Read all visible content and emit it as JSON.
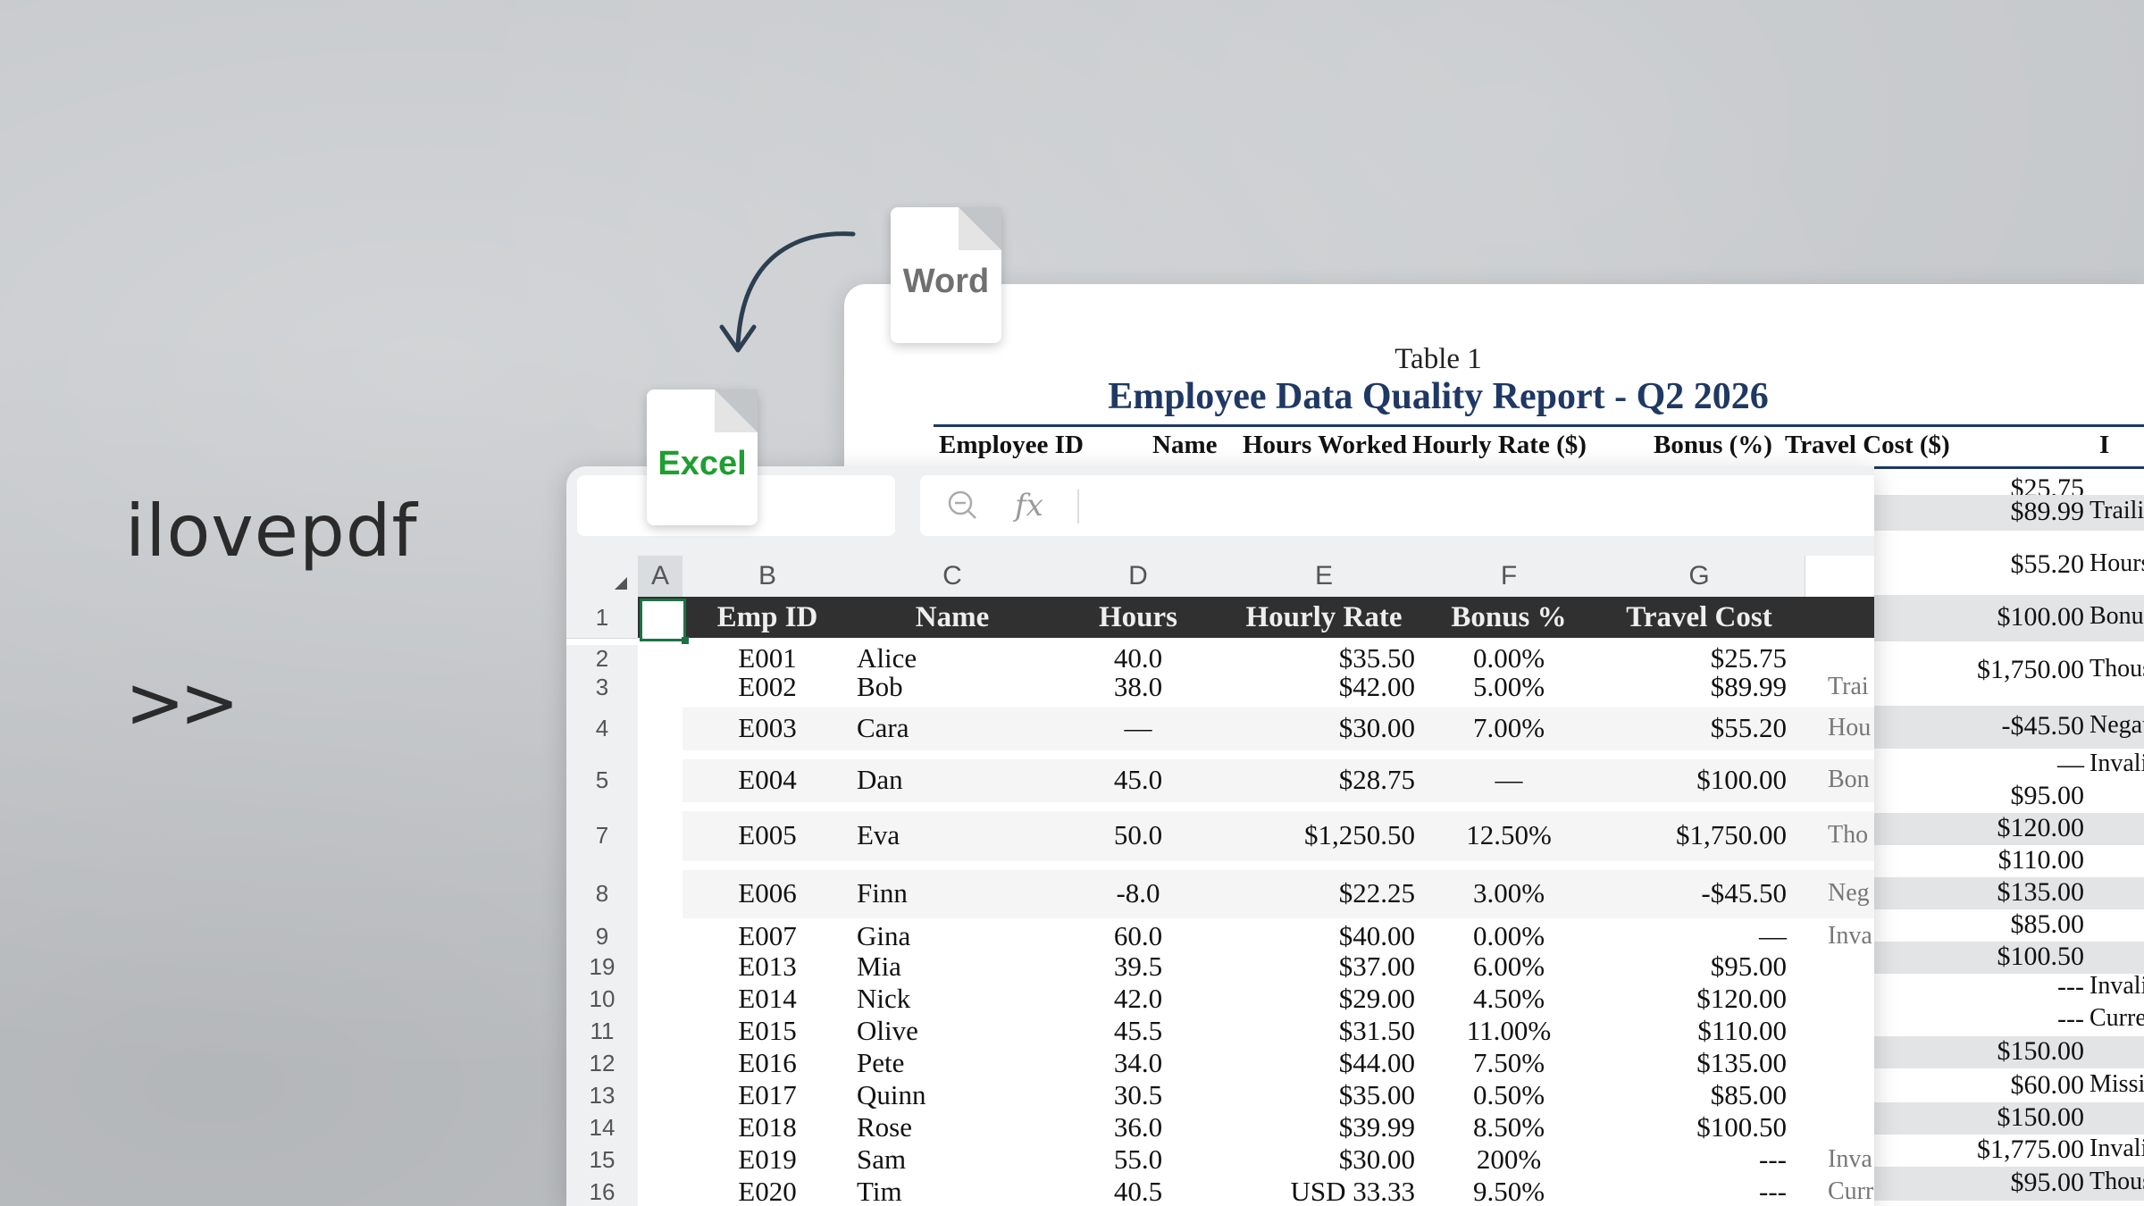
{
  "brand": {
    "name": "ilovepdf",
    "chevrons": ">>"
  },
  "files": {
    "word_label": "Word",
    "excel_label": "Excel",
    "word_color": "#707070",
    "excel_color": "#1f9e31"
  },
  "word_doc": {
    "caption": "Table 1",
    "title": "Employee Data Quality Report - Q2 2026",
    "headers": [
      "Employee ID",
      "Name",
      "Hours Worked",
      "Hourly Rate ($)",
      "Bonus (%)",
      "Travel Cost ($)",
      "I"
    ],
    "rows": [
      {
        "amount": "$25.75",
        "note": ""
      },
      {
        "amount": "$89.99",
        "note": "Trailing s"
      },
      {
        "amount": "$55.20",
        "note": "Hours inv"
      },
      {
        "amount": "$100.00",
        "note": "Bonus inv"
      },
      {
        "amount": "$1,750.00",
        "note": "Thousand"
      },
      {
        "amount": "-$45.50",
        "note": "Negative"
      },
      {
        "amount": "—",
        "note": "Invalid bo"
      },
      {
        "amount": "$95.00",
        "note": ""
      },
      {
        "amount": "$120.00",
        "note": ""
      },
      {
        "amount": "$110.00",
        "note": ""
      },
      {
        "amount": "$135.00",
        "note": ""
      },
      {
        "amount": "$85.00",
        "note": ""
      },
      {
        "amount": "$100.50",
        "note": ""
      },
      {
        "amount": "---",
        "note": "Invalid bo"
      },
      {
        "amount": "---",
        "note": "Currency"
      },
      {
        "amount": "$150.00",
        "note": ""
      },
      {
        "amount": "$60.00",
        "note": "Missing h"
      },
      {
        "amount": "$150.00",
        "note": ""
      },
      {
        "amount": "$1,775.00",
        "note": "Invalid bo"
      },
      {
        "amount": "$95.00",
        "note": "Thousand"
      }
    ]
  },
  "excel": {
    "formula_icon": "fx",
    "columns": [
      "A",
      "B",
      "C",
      "D",
      "E",
      "F",
      "G"
    ],
    "header_row": {
      "row_num": "1",
      "cells": [
        "Emp ID",
        "Name",
        "Hours",
        "Hourly Rate",
        "Bonus %",
        "Travel Cost"
      ]
    },
    "rows": [
      {
        "num": "2",
        "id": "E001",
        "name": "Alice",
        "hours": "40.0",
        "rate": "$35.50",
        "bonus": "0.00%",
        "travel": "$25.75",
        "note": ""
      },
      {
        "num": "3",
        "id": "E002",
        "name": "Bob",
        "hours": "38.0",
        "rate": "$42.00",
        "bonus": "5.00%",
        "travel": "$89.99",
        "note": "Trai"
      },
      {
        "num": "4",
        "id": "E003",
        "name": "Cara",
        "hours": "—",
        "rate": "$30.00",
        "bonus": "7.00%",
        "travel": "$55.20",
        "note": "Hou"
      },
      {
        "num": "5",
        "id": "E004",
        "name": "Dan",
        "hours": "45.0",
        "rate": "$28.75",
        "bonus": "—",
        "travel": "$100.00",
        "note": "Bon"
      },
      {
        "num": "7",
        "id": "E005",
        "name": "Eva",
        "hours": "50.0",
        "rate": "$1,250.50",
        "bonus": "12.50%",
        "travel": "$1,750.00",
        "note": "Tho"
      },
      {
        "num": "8",
        "id": "E006",
        "name": "Finn",
        "hours": "-8.0",
        "rate": "$22.25",
        "bonus": "3.00%",
        "travel": "-$45.50",
        "note": "Neg"
      },
      {
        "num": "9",
        "id": "E007",
        "name": "Gina",
        "hours": "60.0",
        "rate": "$40.00",
        "bonus": "0.00%",
        "travel": "—",
        "note": "Inva"
      },
      {
        "num": "19",
        "id": "E013",
        "name": "Mia",
        "hours": "39.5",
        "rate": "$37.00",
        "bonus": "6.00%",
        "travel": "$95.00",
        "note": ""
      },
      {
        "num": "10",
        "id": "E014",
        "name": "Nick",
        "hours": "42.0",
        "rate": "$29.00",
        "bonus": "4.50%",
        "travel": "$120.00",
        "note": ""
      },
      {
        "num": "11",
        "id": "E015",
        "name": "Olive",
        "hours": "45.5",
        "rate": "$31.50",
        "bonus": "11.00%",
        "travel": "$110.00",
        "note": ""
      },
      {
        "num": "12",
        "id": "E016",
        "name": "Pete",
        "hours": "34.0",
        "rate": "$44.00",
        "bonus": "7.50%",
        "travel": "$135.00",
        "note": ""
      },
      {
        "num": "13",
        "id": "E017",
        "name": "Quinn",
        "hours": "30.5",
        "rate": "$35.00",
        "bonus": "0.50%",
        "travel": "$85.00",
        "note": ""
      },
      {
        "num": "14",
        "id": "E018",
        "name": "Rose",
        "hours": "36.0",
        "rate": "$39.99",
        "bonus": "8.50%",
        "travel": "$100.50",
        "note": ""
      },
      {
        "num": "15",
        "id": "E019",
        "name": "Sam",
        "hours": "55.0",
        "rate": "$30.00",
        "bonus": "200%",
        "travel": "---",
        "note": "Inva"
      },
      {
        "num": "16",
        "id": "E020",
        "name": "Tim",
        "hours": "40.5",
        "rate": "USD 33.33",
        "bonus": "9.50%",
        "travel": "---",
        "note": "Curr"
      }
    ]
  }
}
